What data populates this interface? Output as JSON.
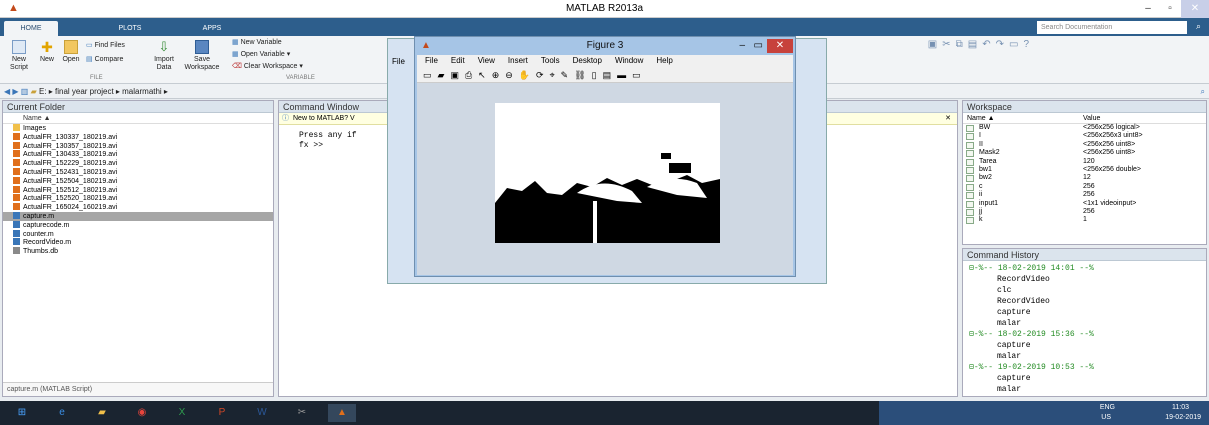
{
  "app": {
    "title": "MATLAB R2013a",
    "window_controls": [
      "minimize-icon",
      "restore-icon",
      "close-icon"
    ]
  },
  "ribbon_tabs": [
    "HOME",
    "PLOTS",
    "APPS"
  ],
  "search": {
    "placeholder": "Search Documentation"
  },
  "ribbon": {
    "file_group": "FILE",
    "variable_group": "VARIABLE",
    "new_script": "New\nScript",
    "new": "New",
    "open": "Open",
    "find_files": "Find Files",
    "compare": "Compare",
    "import_data": "Import\nData",
    "save_workspace": "Save\nWorkspace",
    "new_variable": "New Variable",
    "open_variable": "Open Variable",
    "clear_workspace": "Clear Workspace"
  },
  "address": {
    "path": "E: ▸ final year project ▸ malarmathi ▸"
  },
  "current_folder": {
    "title": "Current Folder",
    "col_name": "Name ▲",
    "items": [
      {
        "name": "Images",
        "type": "folder"
      },
      {
        "name": "ActualFR_130337_180219.avi",
        "type": "avi"
      },
      {
        "name": "ActualFR_130357_180219.avi",
        "type": "avi"
      },
      {
        "name": "ActualFR_130433_180219.avi",
        "type": "avi"
      },
      {
        "name": "ActualFR_152229_180219.avi",
        "type": "avi"
      },
      {
        "name": "ActualFR_152431_180219.avi",
        "type": "avi"
      },
      {
        "name": "ActualFR_152504_180219.avi",
        "type": "avi"
      },
      {
        "name": "ActualFR_152512_180219.avi",
        "type": "avi"
      },
      {
        "name": "ActualFR_152520_180219.avi",
        "type": "avi"
      },
      {
        "name": "ActualFR_165024_160219.avi",
        "type": "avi"
      },
      {
        "name": "capture.m",
        "type": "m",
        "selected": true
      },
      {
        "name": "capturecode.m",
        "type": "m"
      },
      {
        "name": "counter.m",
        "type": "m"
      },
      {
        "name": "RecordVideo.m",
        "type": "m"
      },
      {
        "name": "Thumbs.db",
        "type": "db"
      }
    ],
    "status": "capture.m (MATLAB Script)"
  },
  "command_window": {
    "title": "Command Window",
    "notice": "New to MATLAB? V",
    "lines": [
      "Press any if",
      "fx >>"
    ]
  },
  "figure": {
    "title": "Figure 3",
    "menu": [
      "File",
      "Edit",
      "View",
      "Insert",
      "Tools",
      "Desktop",
      "Window",
      "Help"
    ]
  },
  "bg_window": {
    "menu_label": "File"
  },
  "workspace": {
    "title": "Workspace",
    "col_name": "Name ▲",
    "col_value": "Value",
    "rows": [
      {
        "name": "BW",
        "value": "<256x256 logical>"
      },
      {
        "name": "I",
        "value": "<256x256x3 uint8>"
      },
      {
        "name": "II",
        "value": "<256x256 uint8>"
      },
      {
        "name": "Mask2",
        "value": "<256x256 uint8>"
      },
      {
        "name": "Tarea",
        "value": "120"
      },
      {
        "name": "bw1",
        "value": "<256x256 double>"
      },
      {
        "name": "bw2",
        "value": "12"
      },
      {
        "name": "c",
        "value": "256"
      },
      {
        "name": "ii",
        "value": "256"
      },
      {
        "name": "input1",
        "value": "<1x1 videoinput>"
      },
      {
        "name": "jj",
        "value": "256"
      },
      {
        "name": "k",
        "value": "1"
      }
    ]
  },
  "command_history": {
    "title": "Command History",
    "lines": [
      {
        "kind": "d",
        "text": "⊟-%-- 18-02-2019 14:01 --%"
      },
      {
        "kind": "c",
        "text": "RecordVideo"
      },
      {
        "kind": "c",
        "text": "clc"
      },
      {
        "kind": "c",
        "text": "RecordVideo"
      },
      {
        "kind": "c",
        "text": "capture"
      },
      {
        "kind": "c",
        "text": "malar"
      },
      {
        "kind": "d",
        "text": "⊟-%-- 18-02-2019 15:36 --%"
      },
      {
        "kind": "c",
        "text": "capture"
      },
      {
        "kind": "c",
        "text": "malar"
      },
      {
        "kind": "d",
        "text": "⊟-%-- 19-02-2019 10:53 --%"
      },
      {
        "kind": "c",
        "text": "capture"
      },
      {
        "kind": "c",
        "text": "malar"
      }
    ]
  },
  "taskbar": {
    "lang": "ENG",
    "region": "US",
    "time": "11:03",
    "date": "19-02-2019"
  }
}
